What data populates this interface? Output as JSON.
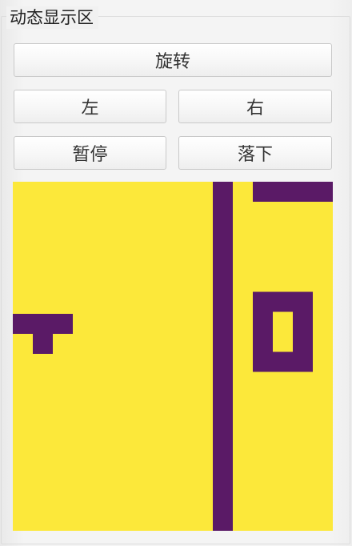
{
  "section": {
    "legend": "动态显示区"
  },
  "controls": {
    "rotate_label": "旋转",
    "left_label": "左",
    "right_label": "右",
    "pause_label": "暂停",
    "drop_label": "落下"
  },
  "board": {
    "columns": 16,
    "rows": 17.5,
    "background_color": "#fce83a",
    "block_color": "#5a1a66",
    "filled_cells": [
      [
        10,
        0
      ],
      [
        10,
        1
      ],
      [
        10,
        2
      ],
      [
        10,
        3
      ],
      [
        10,
        4
      ],
      [
        10,
        5
      ],
      [
        10,
        6
      ],
      [
        10,
        7
      ],
      [
        10,
        8
      ],
      [
        10,
        9
      ],
      [
        10,
        10
      ],
      [
        10,
        11
      ],
      [
        10,
        12
      ],
      [
        10,
        13
      ],
      [
        10,
        14
      ],
      [
        10,
        15
      ],
      [
        10,
        16
      ],
      [
        10,
        17
      ],
      [
        12,
        0
      ],
      [
        13,
        0
      ],
      [
        14,
        0
      ],
      [
        15,
        0
      ],
      [
        12,
        5.5
      ],
      [
        13,
        5.5
      ],
      [
        14,
        5.5
      ],
      [
        12,
        6.5
      ],
      [
        14,
        6.5
      ],
      [
        12,
        7.5
      ],
      [
        14,
        7.5
      ],
      [
        12,
        8.5
      ],
      [
        13,
        8.5
      ],
      [
        14,
        8.5
      ],
      [
        0,
        6.6
      ],
      [
        1,
        6.6
      ],
      [
        2,
        6.6
      ],
      [
        1,
        7.6
      ]
    ]
  }
}
